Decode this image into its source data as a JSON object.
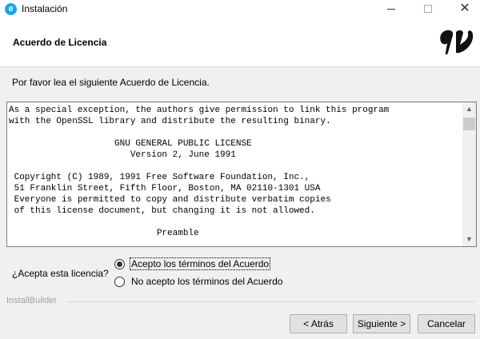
{
  "window": {
    "title": "Instalación",
    "minimize_glyph": "",
    "maximize_glyph": "",
    "close_glyph": "✕"
  },
  "header": {
    "title": "Acuerdo de Licencia"
  },
  "subtitle": "Por favor lea el siguiente Acuerdo de Licencia.",
  "license": {
    "text": "As a special exception, the authors give permission to link this program\nwith the OpenSSL library and distribute the resulting binary.\n\n                    GNU GENERAL PUBLIC LICENSE\n                       Version 2, June 1991\n\n Copyright (C) 1989, 1991 Free Software Foundation, Inc.,\n 51 Franklin Street, Fifth Floor, Boston, MA 02110-1301 USA\n Everyone is permitted to copy and distribute verbatim copies\n of this license document, but changing it is not allowed.\n\n                            Preamble"
  },
  "question": "¿Acepta esta licencia?",
  "options": [
    {
      "label": "Acepto los términos del Acuerdo",
      "selected": true
    },
    {
      "label": "No acepto los términos del Acuerdo",
      "selected": false
    }
  ],
  "footer": {
    "brand": "InstallBuilder",
    "back_label": "< Atrás",
    "next_label": "Siguiente >",
    "cancel_label": "Cancelar"
  },
  "icons": {
    "app": "installer-app-icon",
    "logo": "installbuilder-logo-icon",
    "scroll_up": "chevron-up-icon",
    "scroll_down": "chevron-down-icon"
  },
  "colors": {
    "app_icon": "#1aa4e8",
    "header_bg": "#ffffff",
    "dialog_bg": "#f0f0f0",
    "button_bg": "#e1e1e1"
  }
}
